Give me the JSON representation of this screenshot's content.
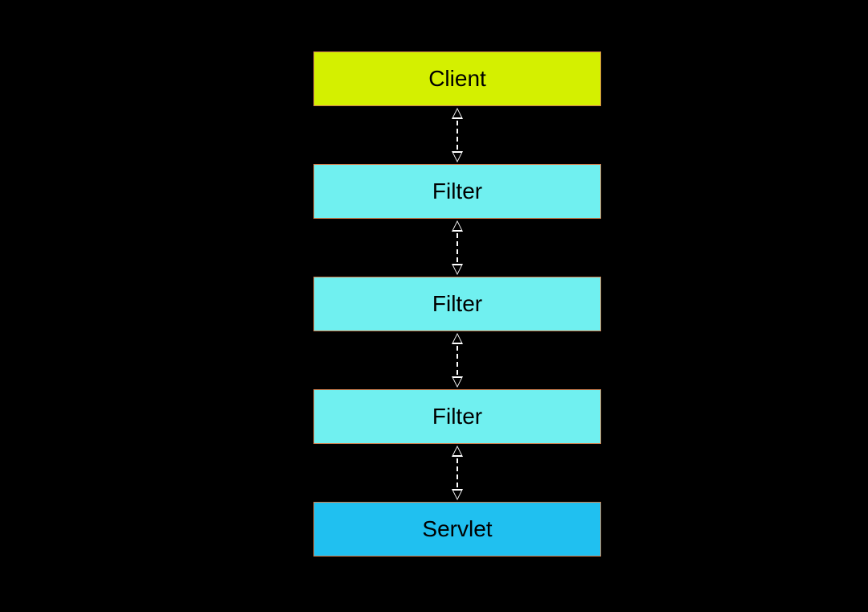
{
  "nodes": {
    "client": "Client",
    "filter1": "Filter",
    "filter2": "Filter",
    "filter3": "Filter",
    "servlet": "Servlet"
  },
  "colors": {
    "client_bg": "#d4f000",
    "filter_bg": "#70f0f0",
    "servlet_bg": "#20c0f0",
    "border": "#d08050",
    "page_bg": "#000000"
  }
}
